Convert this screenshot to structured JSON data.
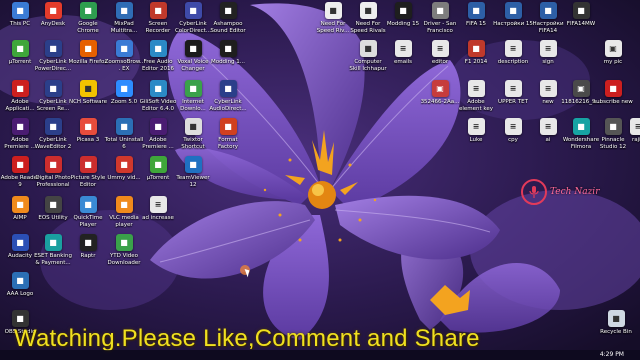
{
  "colors": {
    "marquee": "#f0e020",
    "petal": "#7a52c4",
    "petal_dark": "#3e2470",
    "stamen": "#f3a31f",
    "watermark": "#e23a5a"
  },
  "desktop": {
    "icons": [
      {
        "label": "This PC",
        "icon": "pc-icon",
        "color": "#3a7bd5"
      },
      {
        "label": "AnyDesk",
        "icon": "anydesk-icon",
        "color": "#e43b2b"
      },
      {
        "label": "Google Chrome",
        "icon": "chrome-icon",
        "color": "#2e9e4f"
      },
      {
        "label": "MixPad Multitra...",
        "icon": "mixpad-icon",
        "color": "#2f6db5"
      },
      {
        "label": "Screen Recorder",
        "icon": "recorder-icon",
        "color": "#c0392b"
      },
      {
        "label": "CyberLink ColorDirect...",
        "icon": "colordirector-icon",
        "color": "#3e4aa8"
      },
      {
        "label": "Ashampoo Sound Editor",
        "icon": "sound-editor-icon",
        "color": "#222222"
      },
      {
        "label": "Need For Speed Riv...",
        "icon": "nfs-rivals-icon",
        "color": "#eeeeee"
      },
      {
        "label": "Need For Speed Rivals",
        "icon": "nfs-rivals-icon",
        "color": "#eeeeee"
      },
      {
        "label": "Modding 15",
        "icon": "modding-icon",
        "color": "#1e1e1e"
      },
      {
        "label": "Driver - San Francisco",
        "icon": "driver-icon",
        "color": "#7d7d7d"
      },
      {
        "label": "FIFA 15",
        "icon": "fifa15-icon",
        "color": "#2d5fa6"
      },
      {
        "label": "Настройки 15",
        "icon": "settings-15-icon",
        "color": "#2d5fa6"
      },
      {
        "label": "Настройки FIFA14",
        "icon": "settings-fifa14-icon",
        "color": "#2d5fa6"
      },
      {
        "label": "FIFA14MW",
        "icon": "fifa14mw-icon",
        "color": "#333333"
      },
      {
        "label": "µTorrent",
        "icon": "utorrent-icon",
        "color": "#3fa63a"
      },
      {
        "label": "CyberLink PowerDirec...",
        "icon": "powerdirector-icon",
        "color": "#2b3f8a"
      },
      {
        "label": "Mozilla Firefox",
        "icon": "firefox-icon",
        "color": "#e66000"
      },
      {
        "label": "ZoomsoBrow... EX",
        "icon": "browser-icon",
        "color": "#3a7bd5"
      },
      {
        "label": "Free Audio Editor 2016",
        "icon": "audio-editor-icon",
        "color": "#2b8ac6"
      },
      {
        "label": "Voxal Voice Changer",
        "icon": "voxal-icon",
        "color": "#1b1b1b"
      },
      {
        "label": "Modding 1...",
        "icon": "modding-icon",
        "color": "#1e1e1e"
      },
      {
        "label": "Computer Skill Ichhapur",
        "icon": "folder-icon",
        "color": "#dddddd"
      },
      {
        "label": "emails",
        "icon": "file-icon",
        "color": "#e8e8e8"
      },
      {
        "label": "editor",
        "icon": "file-icon",
        "color": "#e8e8e8"
      },
      {
        "label": "F1 2014",
        "icon": "f1-2014-icon",
        "color": "#c0392b"
      },
      {
        "label": "description",
        "icon": "file-icon",
        "color": "#e8e8e8"
      },
      {
        "label": "sign",
        "icon": "file-icon",
        "color": "#e8e8e8"
      },
      {
        "label": "my pic",
        "icon": "image-icon",
        "color": "#e8e8e8"
      },
      {
        "label": "Adobe Applicati...",
        "icon": "adobe-icon",
        "color": "#cc1f1f"
      },
      {
        "label": "CyberLink Screen Re...",
        "icon": "screen-recorder-icon",
        "color": "#2b3f8a"
      },
      {
        "label": "NCH Software",
        "icon": "nch-icon",
        "color": "#f2c200"
      },
      {
        "label": "Zoom 5.0",
        "icon": "zoom-icon",
        "color": "#2d8cff"
      },
      {
        "label": "GiliSoft Video Editor 6.4.0",
        "icon": "video-editor-icon",
        "color": "#2b8ac6"
      },
      {
        "label": "Internet Downlo...",
        "icon": "idm-icon",
        "color": "#3aa14a"
      },
      {
        "label": "CyberLink AudioDirect...",
        "icon": "audiodirector-icon",
        "color": "#2b3f8a"
      },
      {
        "label": "352466-2Aa...",
        "icon": "image-icon",
        "color": "#c63c3c"
      },
      {
        "label": "Adobe element key",
        "icon": "file-icon",
        "color": "#e8e8e8"
      },
      {
        "label": "UPPER TET",
        "icon": "file-icon",
        "color": "#e8e8e8"
      },
      {
        "label": "new",
        "icon": "file-icon",
        "color": "#e8e8e8"
      },
      {
        "label": "11816216_9...",
        "icon": "image-icon",
        "color": "#4a4a4a"
      },
      {
        "label": "subscribe new",
        "icon": "subscribe-icon",
        "color": "#cc1f1f"
      },
      {
        "label": "Adobe Premiere ...",
        "icon": "premiere-icon",
        "color": "#4a1c72"
      },
      {
        "label": "CyberLink WaveEditor 2",
        "icon": "waveeditor-icon",
        "color": "#2b3f8a"
      },
      {
        "label": "Picasa 3",
        "icon": "picasa-icon",
        "color": "#e74c3c"
      },
      {
        "label": "Total Uninstall 6",
        "icon": "uninstall-icon",
        "color": "#2b6fb5"
      },
      {
        "label": "Adobe Premiere ...",
        "icon": "premiere-icon",
        "color": "#4a1c72"
      },
      {
        "label": "Twixtor Shortcut",
        "icon": "shortcut-icon",
        "color": "#dddddd"
      },
      {
        "label": "Format Factory",
        "icon": "format-factory-icon",
        "color": "#d04020"
      },
      {
        "label": "Luke",
        "icon": "file-icon",
        "color": "#e8e8e8"
      },
      {
        "label": "cpy",
        "icon": "file-icon",
        "color": "#e8e8e8"
      },
      {
        "label": "ai",
        "icon": "file-icon",
        "color": "#e8e8e8"
      },
      {
        "label": "Wondershare Filmora",
        "icon": "filmora-icon",
        "color": "#17a3a3"
      },
      {
        "label": "Pinnacle Studio 12",
        "icon": "pinnacle-icon",
        "color": "#555555"
      },
      {
        "label": "rajiv",
        "icon": "file-icon",
        "color": "#e8e8e8"
      },
      {
        "label": "Adobe Reader 9",
        "icon": "reader-icon",
        "color": "#cc1f1f"
      },
      {
        "label": "Digital Photo Professional",
        "icon": "photo-pro-icon",
        "color": "#cc2d2d"
      },
      {
        "label": "Picture Style Editor",
        "icon": "style-editor-icon",
        "color": "#cc2d2d"
      },
      {
        "label": "Ummy vid...",
        "icon": "ummy-icon",
        "color": "#d0382c"
      },
      {
        "label": "µTorrent",
        "icon": "utorrent-icon",
        "color": "#3fa63a"
      },
      {
        "label": "TeamViewer 12",
        "icon": "teamviewer-icon",
        "color": "#1f70c1"
      },
      {
        "label": "AIMP",
        "icon": "aimp-icon",
        "color": "#f08a1c"
      },
      {
        "label": "EOS Utility",
        "icon": "eos-icon",
        "color": "#444444"
      },
      {
        "label": "QuickTime Player",
        "icon": "quicktime-icon",
        "color": "#3a8ad4"
      },
      {
        "label": "VLC media player",
        "icon": "vlc-icon",
        "color": "#f08a1c"
      },
      {
        "label": "ad increase",
        "icon": "file-icon",
        "color": "#e8e8e8"
      },
      {
        "label": "Audacity",
        "icon": "audacity-icon",
        "color": "#2b4fb5"
      },
      {
        "label": "ESET Banking & Payment...",
        "icon": "eset-icon",
        "color": "#1aa0a0"
      },
      {
        "label": "Raptr",
        "icon": "raptr-icon",
        "color": "#222222"
      },
      {
        "label": "YTD Video Downloader",
        "icon": "ytd-icon",
        "color": "#3aa14a"
      },
      {
        "label": "AAA Logo",
        "icon": "logo-icon",
        "color": "#2b6fb5"
      },
      {
        "label": "OBS Studio",
        "icon": "obs-icon",
        "color": "#333333"
      },
      {
        "label": "Recycle Bin",
        "icon": "recycle-bin-icon",
        "color": "#cfd8e3"
      }
    ]
  },
  "overlay": {
    "marquee": "Watching.Please Like,Comment and Share",
    "watermark": "Tech Nazir"
  },
  "taskbar": {
    "time": "4:29 PM"
  }
}
